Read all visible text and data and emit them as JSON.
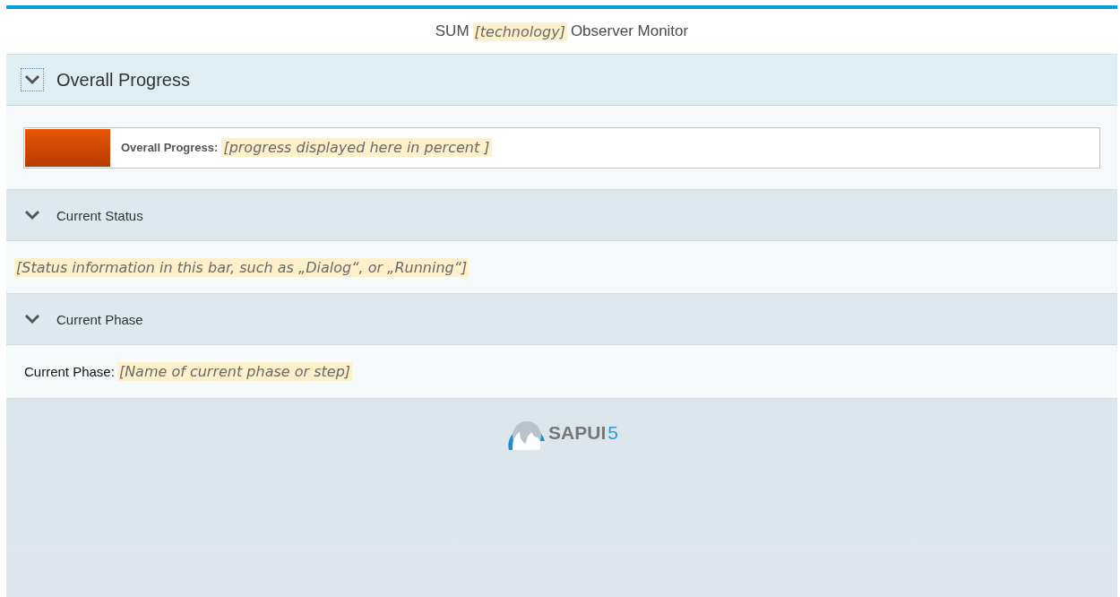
{
  "header": {
    "title_prefix": "SUM",
    "title_placeholder": "[technology]",
    "title_suffix": "Observer Monitor"
  },
  "sections": [
    {
      "kind": "progress",
      "title": "Overall Progress",
      "expanded": true,
      "focused": true,
      "large": true,
      "label": "Overall Progress:",
      "placeholder": "[progress displayed here in percent ]",
      "level": 0.08
    },
    {
      "kind": "status",
      "title": "Current Status",
      "expanded": true,
      "focused": false,
      "large": false,
      "placeholder": "[Status information in this bar, such as „Dialog“, or „Running“]"
    },
    {
      "kind": "phase",
      "title": "Current Phase",
      "expanded": true,
      "focused": false,
      "large": false,
      "label": "Current Phase:",
      "placeholder": "[Name of current phase or step]"
    }
  ],
  "logo": {
    "main": "SAPUI",
    "suffix": "5"
  }
}
